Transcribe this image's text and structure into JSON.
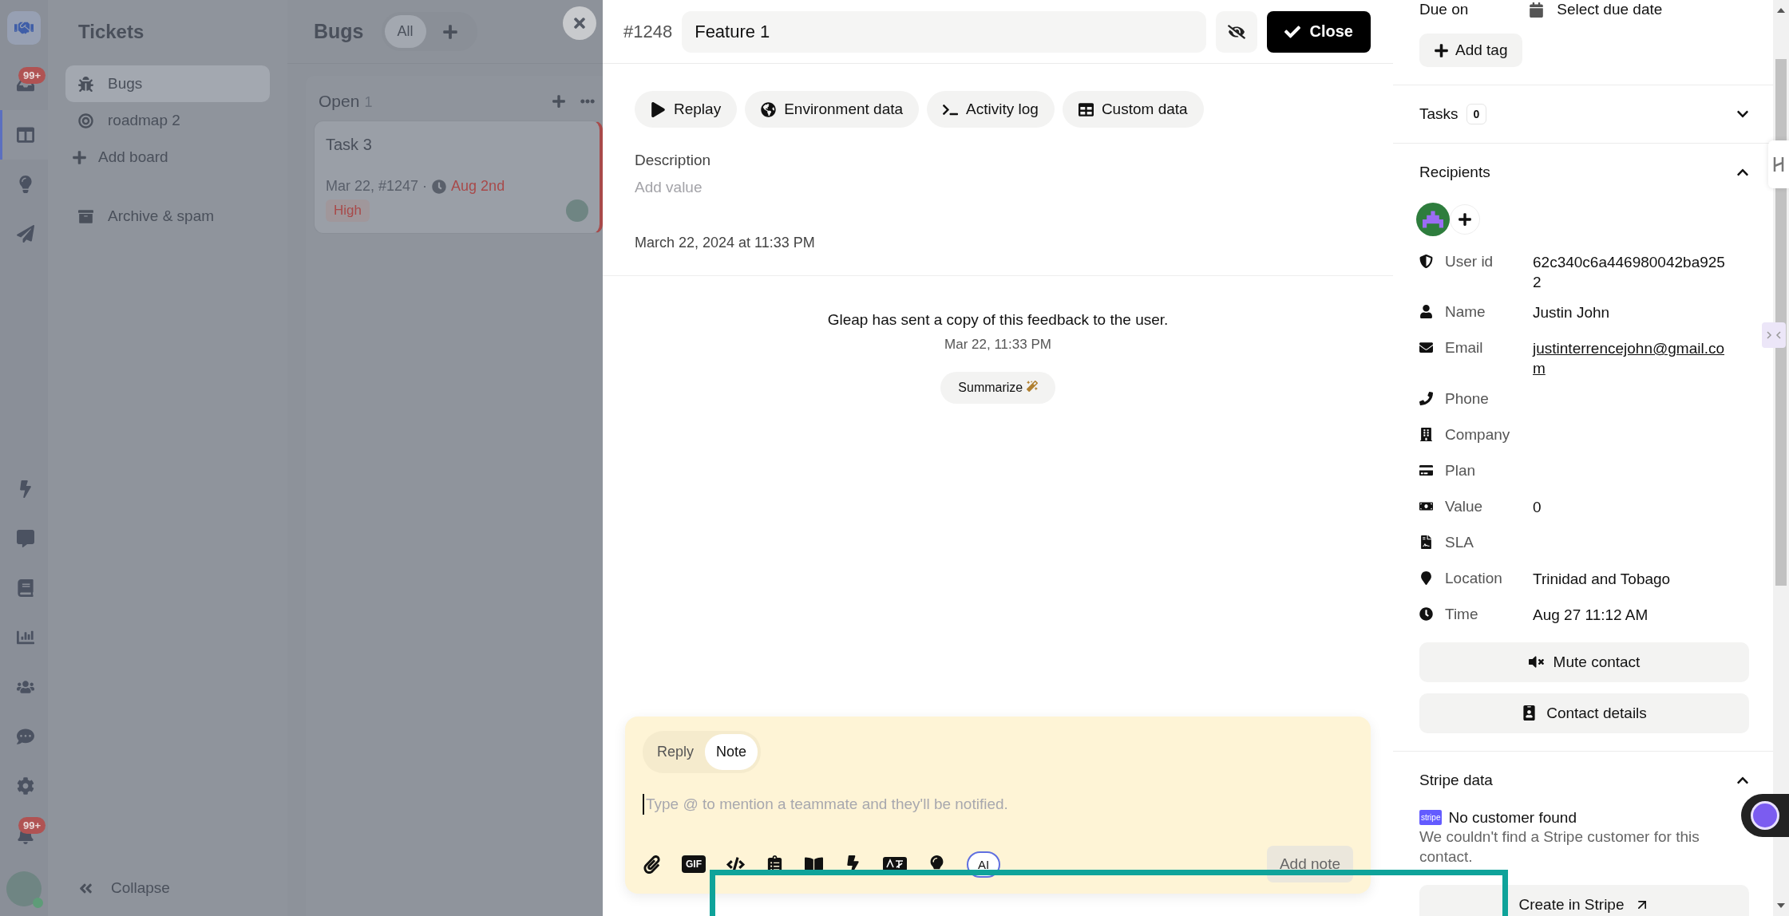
{
  "rail": {
    "items": [
      {
        "selected": false,
        "badge": "99+"
      },
      {
        "selected": true
      },
      {
        "selected": false
      },
      {
        "selected": false
      }
    ],
    "bottom_items": [
      {
        "selected": false
      },
      {
        "selected": false
      },
      {
        "selected": false
      },
      {
        "selected": false
      },
      {
        "selected": false
      },
      {
        "selected": false
      },
      {
        "selected": false
      },
      {
        "selected": false,
        "badge": "99+"
      }
    ]
  },
  "sidebar": {
    "title": "Tickets",
    "boards": [
      {
        "label": "Bugs",
        "selected": true
      },
      {
        "label": "roadmap 2",
        "selected": false
      }
    ],
    "add_board": "Add board",
    "archive": "Archive & spam",
    "collapse": "Collapse"
  },
  "board": {
    "title": "Bugs",
    "views": [
      {
        "label": "All",
        "selected": true
      }
    ],
    "column": {
      "title": "Open",
      "count": "1",
      "cards": [
        {
          "title": "Task 3",
          "meta": "Mar 22, #1247 ·",
          "due": "Aug 2nd",
          "priority": "High"
        }
      ]
    }
  },
  "ticket": {
    "number": "#1248",
    "title": "Feature 1",
    "close_label": "Close",
    "actions": [
      "Replay",
      "Environment data",
      "Activity log",
      "Custom data"
    ],
    "description": {
      "label": "Description",
      "placeholder": "Add value"
    },
    "created": "March 22, 2024 at 11:33 PM",
    "activity": {
      "message": "Gleap has sent a copy of this feedback to the user.",
      "time": "Mar 22, 11:33 PM",
      "summarize": "Summarize"
    },
    "composer": {
      "modes": [
        {
          "label": "Reply",
          "selected": false
        },
        {
          "label": "Note",
          "selected": true
        }
      ],
      "placeholder": "Type @ to mention a teammate and they'll be notified.",
      "gif_label": "GIF",
      "ai_label": "AI",
      "submit": "Add note"
    }
  },
  "details": {
    "due_on": {
      "label": "Due on",
      "value": "Select due date"
    },
    "add_tag": "Add tag",
    "tasks": {
      "title": "Tasks",
      "count": "0",
      "expanded": false
    },
    "recipients": {
      "title": "Recipients",
      "expanded": true,
      "fields": [
        {
          "label": "User id",
          "value": "62c340c6a446980042ba9252"
        },
        {
          "label": "Name",
          "value": "Justin John"
        },
        {
          "label": "Email",
          "value": "justinterrencejohn@gmail.com",
          "link": true
        },
        {
          "label": "Phone"
        },
        {
          "label": "Company"
        },
        {
          "label": "Plan"
        },
        {
          "label": "Value",
          "value": "0"
        },
        {
          "label": "SLA"
        },
        {
          "label": "Location",
          "value": "Trinidad and Tobago"
        },
        {
          "label": "Time",
          "value": "Aug 27 11:12 AM"
        }
      ],
      "buttons": [
        "Mute contact",
        "Contact details"
      ]
    },
    "stripe": {
      "title": "Stripe data",
      "expanded": true,
      "logo_text": "stripe",
      "status": "No customer found",
      "message": "We couldn't find a Stripe customer for this contact.",
      "button": "Create in Stripe"
    }
  }
}
